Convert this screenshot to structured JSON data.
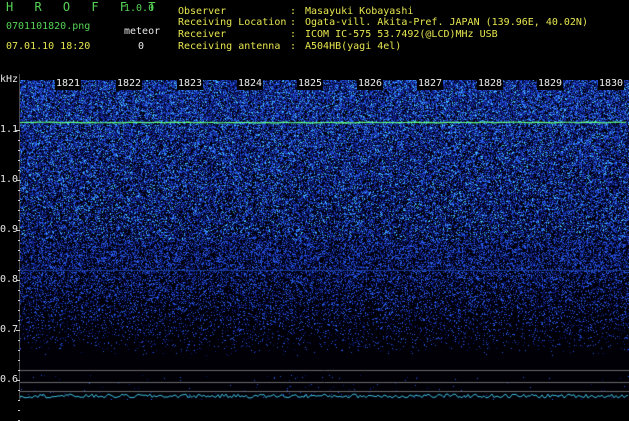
{
  "app": {
    "name": "H R O F F T",
    "version": "1.0.0"
  },
  "file": {
    "name": "0701101820.png",
    "datetime": "07.01.10 18:20"
  },
  "counter": {
    "label": "meteor",
    "value": "0"
  },
  "station": [
    {
      "key": "Observer",
      "value": "Masayuki Kobayashi"
    },
    {
      "key": "Receiving Location",
      "value": "Ogata-vill. Akita-Pref. JAPAN (139.96E, 40.02N)"
    },
    {
      "key": "Receiver",
      "value": "ICOM IC-575 53.7492(@LCD)MHz USB"
    },
    {
      "key": "Receiving antenna",
      "value": "A504HB(yagi 4el)"
    }
  ],
  "y_unit": "kHz",
  "chart_data": {
    "type": "heatmap",
    "x_ticks": [
      "1821",
      "1822",
      "1823",
      "1824",
      "1825",
      "1826",
      "1827",
      "1828",
      "1829",
      "1830"
    ],
    "y_ticks": [
      "1.1",
      "1.0",
      "0.9",
      "0.8",
      "0.7",
      "0.6"
    ],
    "ylim": [
      0.56,
      1.2
    ],
    "carrier_kHz": 1.115,
    "colors": {
      "background": "#000000",
      "low": "#0a1870",
      "mid": "#2a60e0",
      "high": "#50d0ff",
      "carrier": "#60ff80"
    }
  }
}
